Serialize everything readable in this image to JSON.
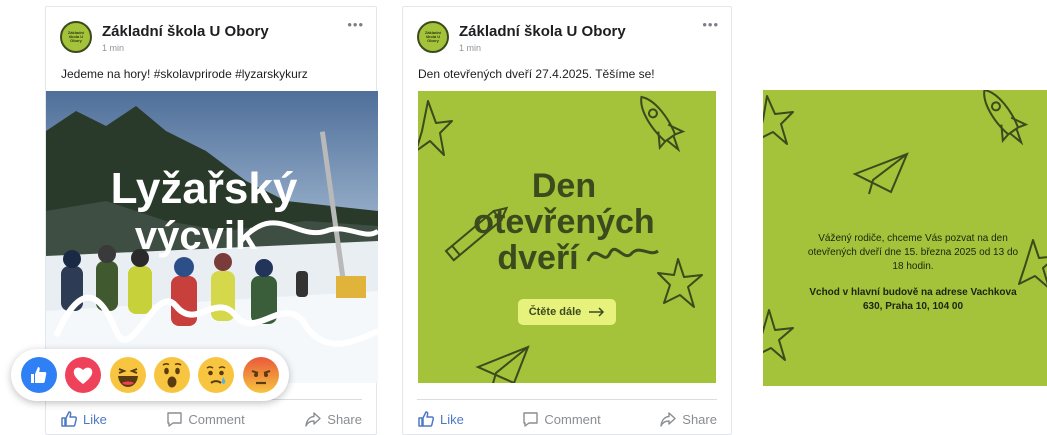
{
  "colors": {
    "brand_green": "#a4c23a",
    "dark_green": "#3d4a1d",
    "like_blue": "#4f78c4",
    "text": "#1c1e21",
    "muted": "#8a8d91"
  },
  "posts": [
    {
      "page_name": "Základní škola U Obory",
      "time": "1 min",
      "text": "Jedeme na hory! #skolavprirode #lyzarskykurz",
      "image": {
        "line1": "Lyžařský",
        "line2": "výcvik"
      },
      "actions": {
        "like": "Like",
        "comment": "Comment",
        "share": "Share"
      }
    },
    {
      "page_name": "Základní škola U Obory",
      "time": "1 min",
      "text": "Den otevřených dveří 27.4.2025. Těšíme se!",
      "image": {
        "line1": "Den",
        "line2": "otevřených",
        "line3": "dveří",
        "cta": "Čtěte dále"
      },
      "actions": {
        "like": "Like",
        "comment": "Comment",
        "share": "Share"
      }
    }
  ],
  "reactions": [
    "like-icon",
    "love-icon",
    "haha-icon",
    "wow-icon",
    "sad-icon",
    "angry-icon"
  ],
  "slide": {
    "paragraph": "Vážený rodiče, chceme Vás pozvat na den otevřených dveří dne 15. března 2025 od 13 do 18 hodin.",
    "bold": "Vchod v hlavní budově na adrese Vachkova 630, Praha 10, 104 00"
  }
}
